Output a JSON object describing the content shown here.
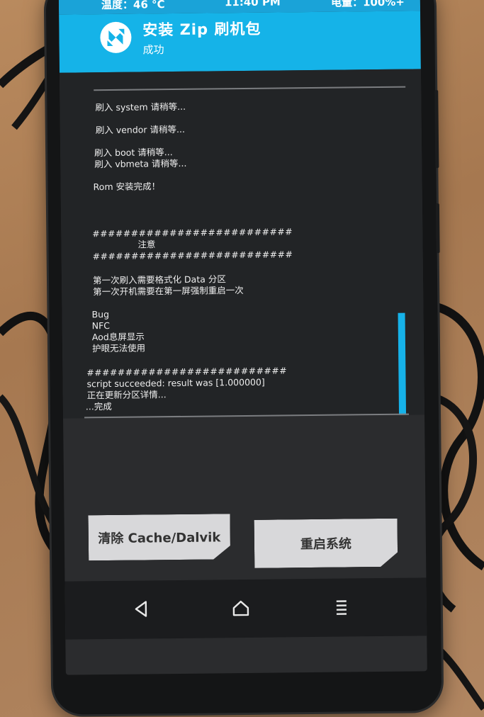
{
  "status_bar": {
    "temperature": "温度：46 °C",
    "time": "11:40 PM",
    "battery": "电量：100%+"
  },
  "header": {
    "title": "安装 Zip 刷机包",
    "subtitle": "成功",
    "logo_icon": "twrp-logo-icon"
  },
  "log": {
    "lines": [
      "刷入 system 请稍等...",
      "刷入 vendor 请稍等...",
      "刷入 boot 请稍等...",
      "刷入 vbmeta 请稍等...",
      "Rom 安装完成！",
      "##########################",
      "注意",
      "##########################",
      "第一次刷入需要格式化 Data 分区",
      "第一次开机需要在第一屏强制重启一次",
      "Bug",
      "NFC",
      "Aod息屏显示",
      "护眼无法使用",
      "##########################",
      "script succeeded: result was [1.000000]",
      "正在更新分区详情...",
      "...完成"
    ]
  },
  "buttons": {
    "wipe_cache_label": "清除 Cache/Dalvik",
    "reboot_label": "重启系统"
  },
  "nav": {
    "back_icon": "back-icon",
    "home_icon": "home-icon",
    "menu_icon": "menu-icon"
  },
  "colors": {
    "accent": "#15b3e8",
    "status_bar": "#1aa3d8",
    "console_bg": "#222426",
    "button_bg": "#d8d8da"
  }
}
